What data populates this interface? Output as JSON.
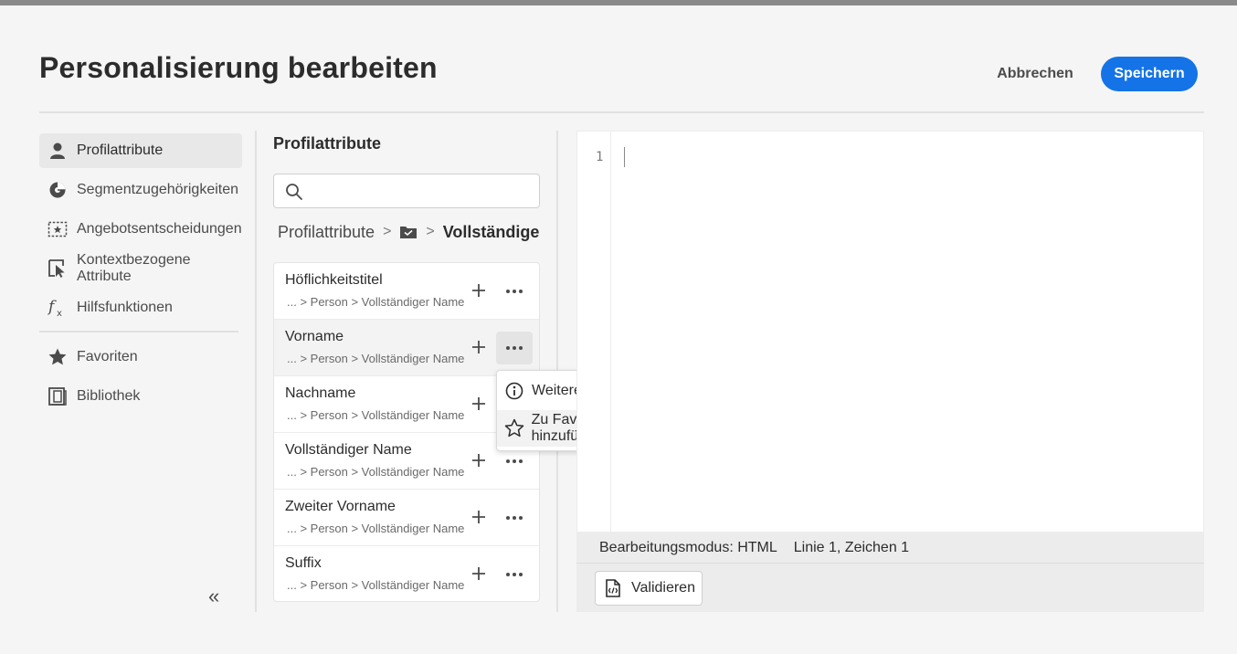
{
  "header": {
    "title": "Personalisierung bearbeiten",
    "cancel_label": "Abbrechen",
    "save_label": "Speichern"
  },
  "colors": {
    "accent": "#1473e6",
    "background": "#f5f5f5"
  },
  "sidebar": {
    "items": [
      {
        "label": "Profilattribute",
        "icon": "person-icon",
        "active": true
      },
      {
        "label": "Segmentzugehörigkeiten",
        "icon": "segment-icon",
        "active": false
      },
      {
        "label": "Angebotsentscheidungen",
        "icon": "offer-decision-icon",
        "active": false
      },
      {
        "label": "Kontextbezogene Attribute",
        "icon": "contextual-attribute-icon",
        "active": false
      },
      {
        "label": "Hilfsfunktionen",
        "icon": "function-icon",
        "active": false
      },
      {
        "label": "Favoriten",
        "icon": "star-icon",
        "active": false
      },
      {
        "label": "Bibliothek",
        "icon": "library-icon",
        "active": false
      }
    ],
    "collapse_label": "«"
  },
  "panel": {
    "title": "Profilattribute",
    "search": {
      "value": "",
      "placeholder": ""
    },
    "breadcrumb": {
      "root": "Profilattribute",
      "separator": ">",
      "folder_icon": "folder-icon",
      "current": "Vollständiger N"
    },
    "attributes": [
      {
        "name": "Höflichkeitstitel",
        "path": "... > Person > Vollständiger Name"
      },
      {
        "name": "Vorname",
        "path": "... > Person > Vollständiger Name"
      },
      {
        "name": "Nachname",
        "path": "... > Person > Vollständiger Name"
      },
      {
        "name": "Vollständiger Name",
        "path": "... > Person > Vollständiger Name"
      },
      {
        "name": "Zweiter Vorname",
        "path": "... > Person > Vollständiger Name"
      },
      {
        "name": "Suffix",
        "path": "... > Person > Vollständiger Name"
      }
    ],
    "add_label": "+",
    "more_label": "···"
  },
  "menu": {
    "items": [
      {
        "label": "Weitere Informationen",
        "icon": "info-icon"
      },
      {
        "label": "Zu Favoriten hinzufügen",
        "icon": "star-outline-icon"
      }
    ]
  },
  "editor": {
    "line_number": "1",
    "mode": "Bearbeitungsmodus: HTML",
    "position": "Linie 1, Zeichen 1",
    "validate_label": "Validieren"
  }
}
